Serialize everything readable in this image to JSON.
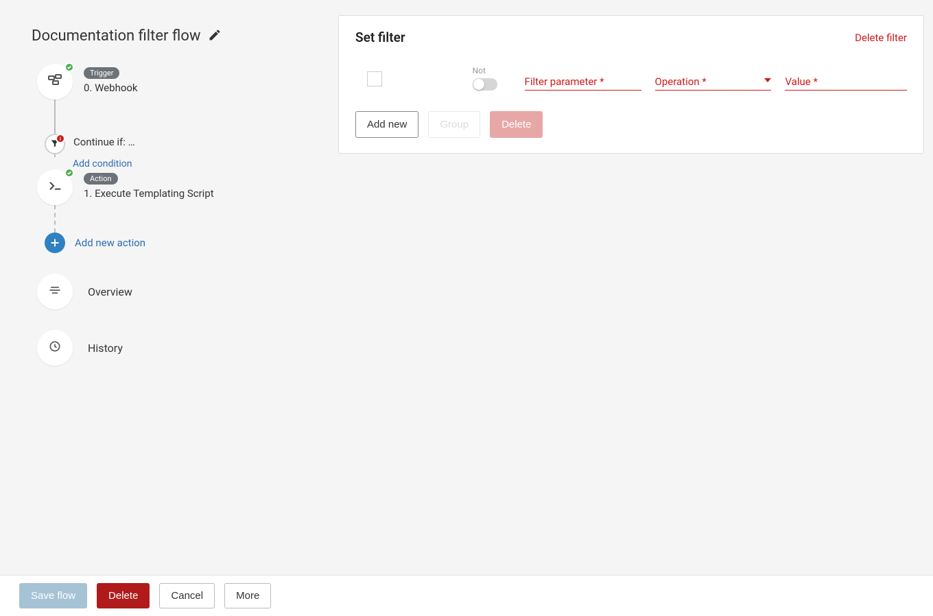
{
  "flow": {
    "title": "Documentation filter flow",
    "trigger_badge": "Trigger",
    "trigger_label": "0. Webhook",
    "condition_label": "Continue if: …",
    "add_condition_label": "Add condition",
    "action_badge": "Action",
    "action_label": "1. Execute Templating Script",
    "add_action_label": "Add new action",
    "overview_label": "Overview",
    "history_label": "History"
  },
  "panel": {
    "title": "Set filter",
    "delete_link": "Delete filter",
    "not_label": "Not",
    "filter_param_label": "Filter parameter *",
    "operation_label": "Operation *",
    "value_label": "Value *",
    "add_new_btn": "Add new",
    "group_btn": "Group",
    "delete_btn": "Delete"
  },
  "footer": {
    "save": "Save flow",
    "delete": "Delete",
    "cancel": "Cancel",
    "more": "More"
  }
}
